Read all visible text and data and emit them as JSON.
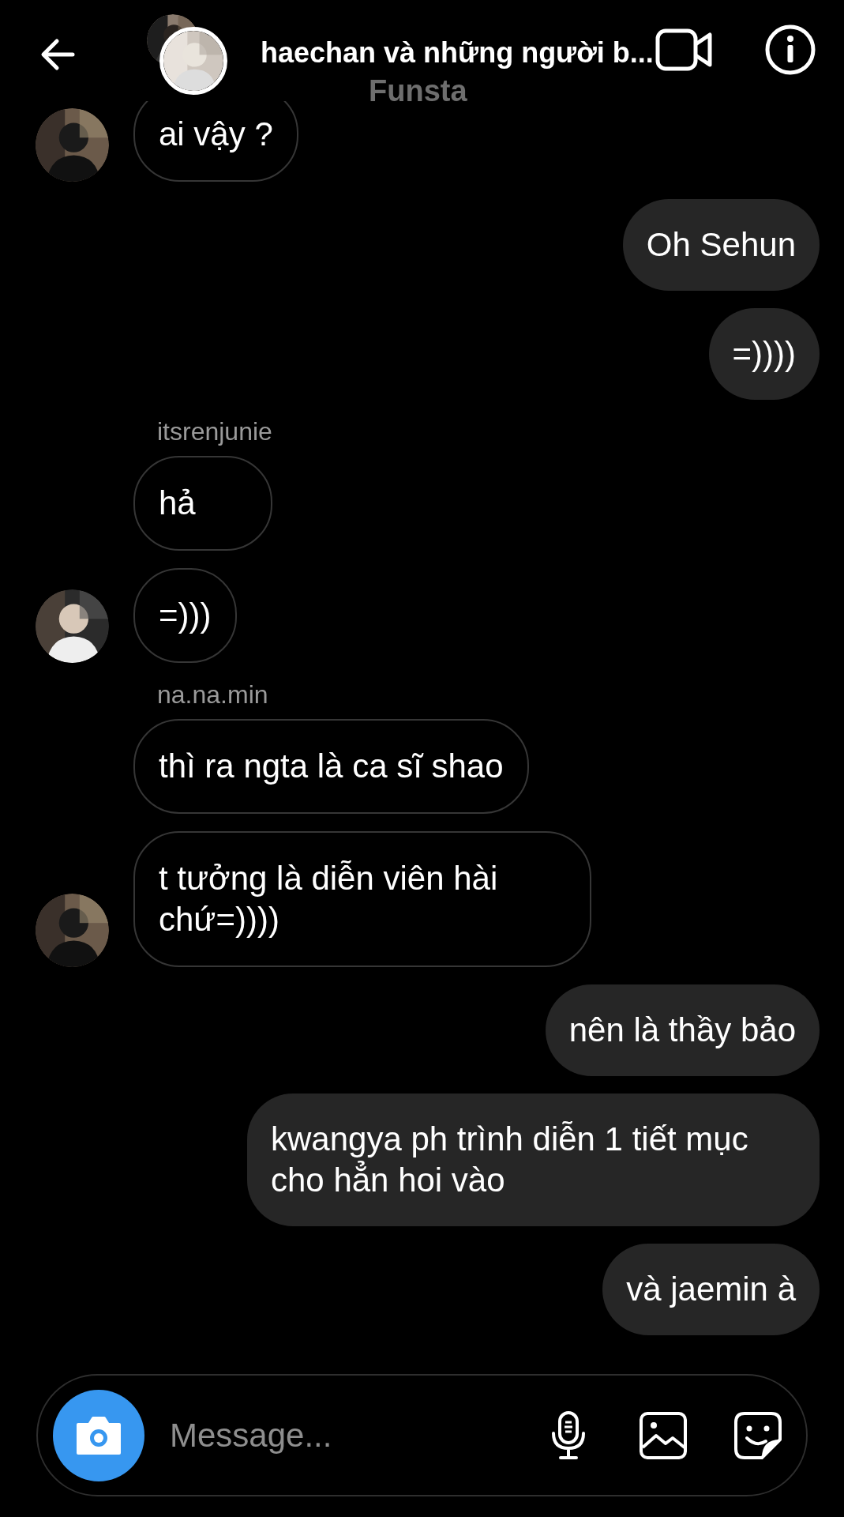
{
  "header": {
    "title": "haechan và những người b...",
    "subtitle": "Funsta"
  },
  "messages": [
    {
      "kind": "incoming",
      "text": "ai vậy ?",
      "avatar": true
    },
    {
      "kind": "outgoing",
      "text": "Oh Sehun"
    },
    {
      "kind": "outgoing",
      "text": "=))))"
    },
    {
      "kind": "incoming",
      "sender": "itsrenjunie",
      "text": "hả",
      "avatar": false
    },
    {
      "kind": "incoming",
      "text": "=)))",
      "avatar": true
    },
    {
      "kind": "incoming",
      "sender": "na.na.min",
      "text": "thì ra ngta là ca sĩ shao",
      "avatar": false
    },
    {
      "kind": "incoming",
      "text": "t tưởng là diễn viên hài chứ=))))",
      "avatar": true
    },
    {
      "kind": "outgoing",
      "text": "nên là thầy bảo"
    },
    {
      "kind": "outgoing",
      "text": "kwangya ph trình diễn 1 tiết mục cho hẳn hoi vào"
    },
    {
      "kind": "outgoing",
      "text": "và jaemin à"
    }
  ],
  "composer": {
    "placeholder": "Message..."
  }
}
